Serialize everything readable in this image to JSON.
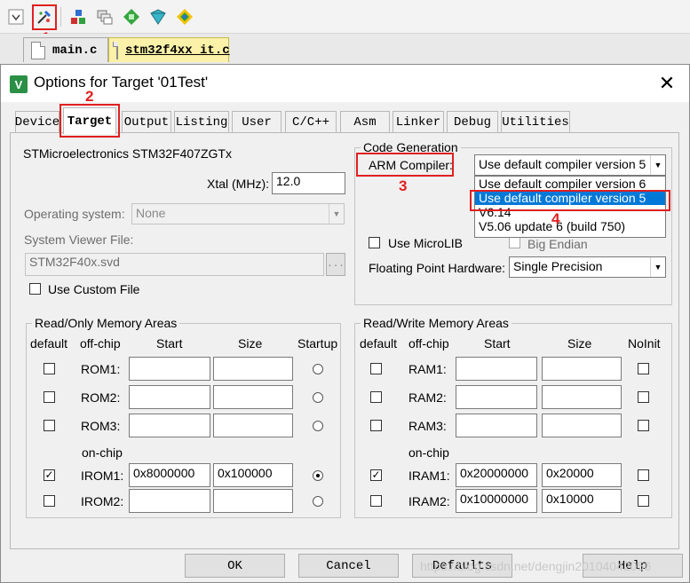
{
  "toolbar": {
    "icons": [
      "dropdown-icon",
      "options-for-target-icon",
      "manage-components-icon",
      "file-extensions-icon",
      "pack-installer-icon",
      "select-packs-icon",
      "run-time-environment-icon"
    ]
  },
  "file_tabs": [
    {
      "label": "main.c",
      "active": false
    },
    {
      "label": "stm32f4xx_it.c",
      "active": true
    }
  ],
  "dialog": {
    "title": "Options for Target '01Test'",
    "close": "✕",
    "tabs": [
      "Device",
      "Target",
      "Output",
      "Listing",
      "User",
      "C/C++",
      "Asm",
      "Linker",
      "Debug",
      "Utilities"
    ],
    "active_tab": "Target"
  },
  "target": {
    "device_name": "STMicroelectronics STM32F407ZGTx",
    "xtal_label": "Xtal (MHz):",
    "xtal_value": "12.0",
    "os_label": "Operating system:",
    "os_value": "None",
    "sv_label": "System Viewer File:",
    "sv_value": "STM32F40x.svd",
    "sv_browse": "...",
    "use_custom_file": "Use Custom File",
    "codegen_title": "Code Generation",
    "arm_compiler_label": "ARM Compiler:",
    "arm_compiler_value": "Use default compiler version 5",
    "compiler_options": [
      "Use default compiler version 6",
      "Use default compiler version 5",
      "V6.14",
      "V5.06 update 6 (build 750)"
    ],
    "compiler_selected_index": 1,
    "use_microlib": "Use MicroLIB",
    "big_endian": "Big Endian",
    "fp_label": "Floating Point Hardware:",
    "fp_value": "Single Precision"
  },
  "ro_memory": {
    "title": "Read/Only Memory Areas",
    "headers": {
      "default": "default",
      "offchip": "off-chip",
      "start": "Start",
      "size": "Size",
      "extra": "Startup"
    },
    "onchip_label": "on-chip",
    "rows": [
      {
        "name": "ROM1:",
        "start": "",
        "size": "",
        "default": false,
        "radio": false
      },
      {
        "name": "ROM2:",
        "start": "",
        "size": "",
        "default": false,
        "radio": false
      },
      {
        "name": "ROM3:",
        "start": "",
        "size": "",
        "default": false,
        "radio": false
      },
      {
        "name": "IROM1:",
        "start": "0x8000000",
        "size": "0x100000",
        "default": true,
        "radio": true
      },
      {
        "name": "IROM2:",
        "start": "",
        "size": "",
        "default": false,
        "radio": false
      }
    ]
  },
  "rw_memory": {
    "title": "Read/Write Memory Areas",
    "headers": {
      "default": "default",
      "offchip": "off-chip",
      "start": "Start",
      "size": "Size",
      "extra": "NoInit"
    },
    "onchip_label": "on-chip",
    "rows": [
      {
        "name": "RAM1:",
        "start": "",
        "size": "",
        "default": false,
        "noinit": false
      },
      {
        "name": "RAM2:",
        "start": "",
        "size": "",
        "default": false,
        "noinit": false
      },
      {
        "name": "RAM3:",
        "start": "",
        "size": "",
        "default": false,
        "noinit": false
      },
      {
        "name": "IRAM1:",
        "start": "0x20000000",
        "size": "0x20000",
        "default": true,
        "noinit": false
      },
      {
        "name": "IRAM2:",
        "start": "0x10000000",
        "size": "0x10000",
        "default": false,
        "noinit": false
      }
    ]
  },
  "buttons": {
    "ok": "OK",
    "cancel": "Cancel",
    "defaults": "Defaults",
    "help": "Help"
  },
  "annotations": [
    "1",
    "2",
    "3",
    "4"
  ],
  "watermark": "https://blog.csdn.net/dengjin20104042056",
  "colors": {
    "annotation_red": "#e02020",
    "selection_blue": "#0078d7"
  }
}
